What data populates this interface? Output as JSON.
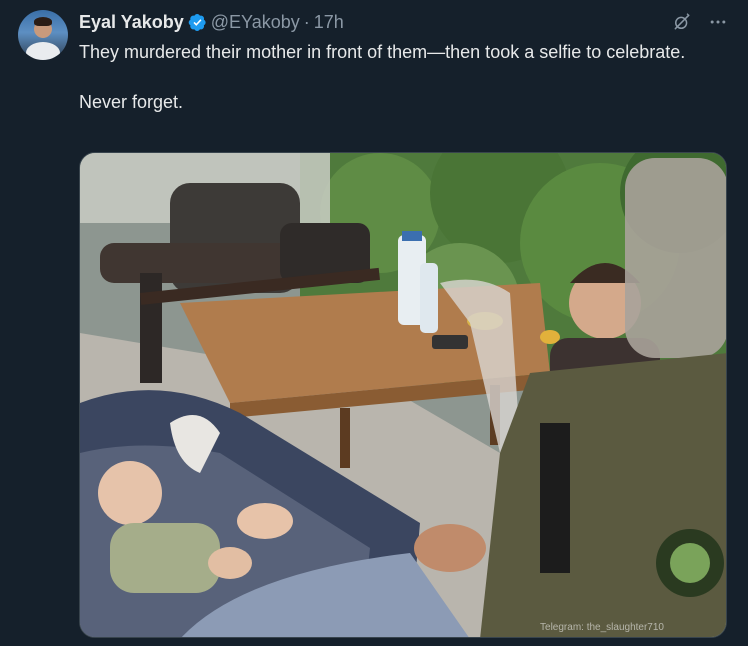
{
  "author": {
    "display_name": "Eyal Yakoby",
    "handle": "@EYakoby",
    "separator": "·",
    "time": "17h",
    "verified_color": "#1d9bf0"
  },
  "tweet": {
    "line1": "They murdered their mother in front of them—then took a selfie to celebrate.",
    "line2": "Never forget."
  },
  "media": {
    "watermark": "Telegram: the_slaughter710"
  },
  "icons": {
    "grok": "grok-icon",
    "more": "more-icon"
  },
  "colors": {
    "background": "#15202b",
    "text": "#e7e9ea",
    "secondary": "#8b98a5",
    "accent": "#1d9bf0"
  }
}
